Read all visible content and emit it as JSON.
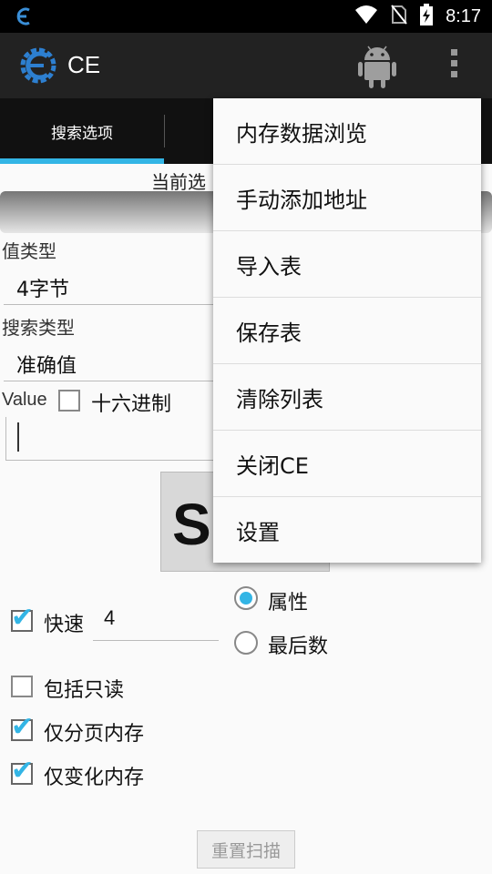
{
  "status_bar": {
    "time": "8:17"
  },
  "app": {
    "title": "CE"
  },
  "tabs": [
    {
      "label": "搜索选项"
    }
  ],
  "current_label": "当前选",
  "value_type": {
    "label": "值类型",
    "value": "4字节"
  },
  "search_type": {
    "label": "搜索类型",
    "value": "准确值"
  },
  "value_field": {
    "label": "Value",
    "hex_label": "十六进制",
    "value": ""
  },
  "scan_button": {
    "label": "S"
  },
  "options": {
    "quick": {
      "label": "快速",
      "value": "4",
      "checked": true
    },
    "readonly": {
      "label": "包括只读",
      "checked": false
    },
    "paged": {
      "label": "仅分页内存",
      "checked": true
    },
    "changed": {
      "label": "仅变化内存",
      "checked": true
    }
  },
  "radios": [
    {
      "label": "属性",
      "selected": true
    },
    {
      "label": "最后数",
      "selected": false
    }
  ],
  "reset_button": "重置扫描",
  "menu": {
    "items": [
      {
        "label": "内存数据浏览"
      },
      {
        "label": "手动添加地址"
      },
      {
        "label": "导入表"
      },
      {
        "label": "保存表"
      },
      {
        "label": "清除列表"
      },
      {
        "label": "关闭CE"
      },
      {
        "label": "设置"
      }
    ]
  },
  "colors": {
    "accent": "#33b5e5",
    "action_bar": "#222222",
    "tab_bar": "#111111"
  },
  "icons": [
    "ce-logo-icon",
    "wifi-icon",
    "no-sim-icon",
    "battery-charging-icon",
    "android-icon",
    "overflow-menu-icon"
  ]
}
